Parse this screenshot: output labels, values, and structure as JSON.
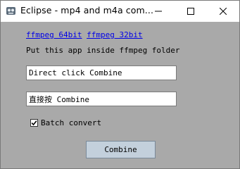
{
  "window": {
    "title": "Eclipse - mp4 and m4a com...",
    "controls": [
      "minimize-icon",
      "maximize-icon",
      "close-icon"
    ]
  },
  "links": {
    "ffmpeg64": "ffmpeg 64bit",
    "ffmpeg32": "ffmpeg 32bit"
  },
  "hint": "Put this app inside ffmpeg folder",
  "inputs": {
    "first_value": "Direct click Combine",
    "second_value": "直接按 Combine"
  },
  "batch": {
    "label": "Batch convert",
    "checked": true
  },
  "combine_label": "Combine"
}
